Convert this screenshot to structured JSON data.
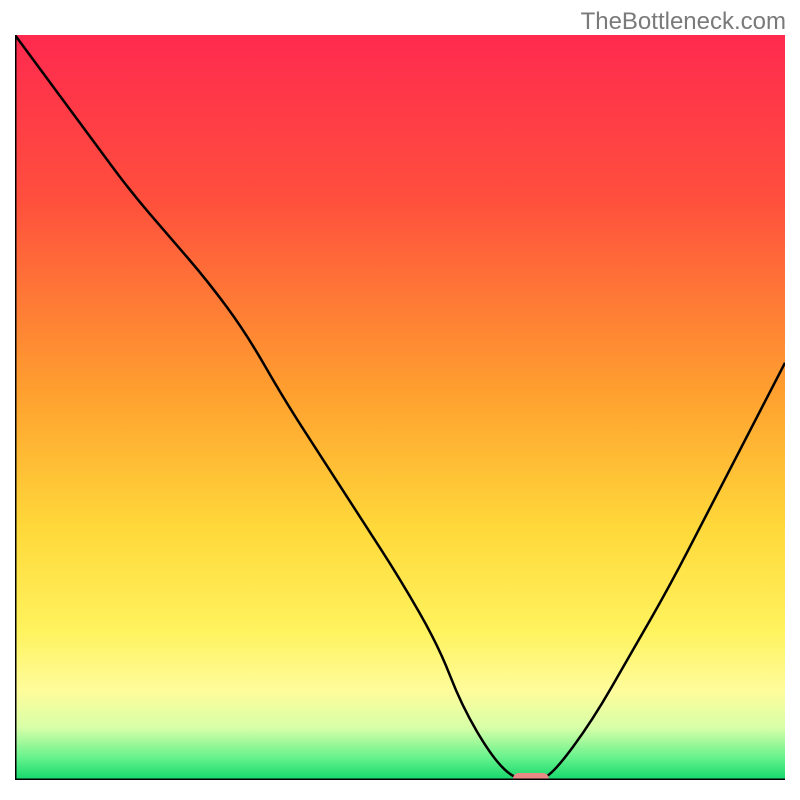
{
  "watermark": "TheBottleneck.com",
  "chart_data": {
    "type": "line",
    "title": "",
    "xlabel": "",
    "ylabel": "",
    "xlim": [
      0,
      100
    ],
    "ylim": [
      0,
      100
    ],
    "x": [
      0,
      5,
      10,
      15,
      20,
      25,
      30,
      35,
      40,
      45,
      50,
      55,
      58,
      62,
      65,
      68,
      70,
      75,
      80,
      85,
      90,
      95,
      100
    ],
    "values": [
      100,
      93,
      86,
      79,
      73,
      67,
      60,
      51,
      43,
      35,
      27,
      18,
      10,
      3,
      0,
      0,
      1,
      8,
      17,
      26,
      36,
      46,
      56
    ],
    "marker": {
      "x": 67,
      "y": 0
    },
    "gradient_bands": {
      "description": "vertical gradient background: red top → orange → yellow → pale → green bottom",
      "stops": [
        [
          "#ff2a4f",
          0.0
        ],
        [
          "#ff4f3d",
          0.22
        ],
        [
          "#ffa02f",
          0.48
        ],
        [
          "#ffd83a",
          0.66
        ],
        [
          "#fff35e",
          0.8
        ],
        [
          "#fffc9b",
          0.88
        ],
        [
          "#d7ffa8",
          0.93
        ],
        [
          "#66f28c",
          0.97
        ],
        [
          "#13d76c",
          1.0
        ]
      ]
    }
  }
}
